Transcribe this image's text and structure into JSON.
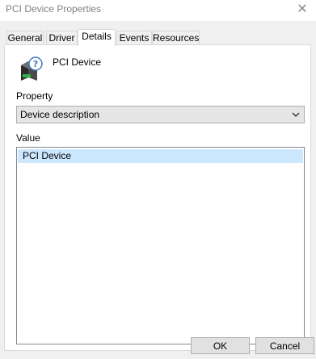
{
  "window": {
    "title": "PCI Device Properties",
    "close_icon": "close-icon"
  },
  "tabs": [
    {
      "label": "General",
      "active": false
    },
    {
      "label": "Driver",
      "active": false
    },
    {
      "label": "Details",
      "active": true
    },
    {
      "label": "Events",
      "active": false
    },
    {
      "label": "Resources",
      "active": false
    }
  ],
  "device": {
    "icon": "unknown-device-icon",
    "name": "PCI Device"
  },
  "property": {
    "label": "Property",
    "selected": "Device description",
    "chevron_icon": "chevron-down-icon"
  },
  "value": {
    "label": "Value",
    "items": [
      "PCI Device"
    ]
  },
  "buttons": {
    "ok": "OK",
    "cancel": "Cancel"
  },
  "colors": {
    "dialog_background": "#f0f0f0",
    "selection_highlight": "#cce8ff",
    "button_background": "#e1e1e1"
  }
}
